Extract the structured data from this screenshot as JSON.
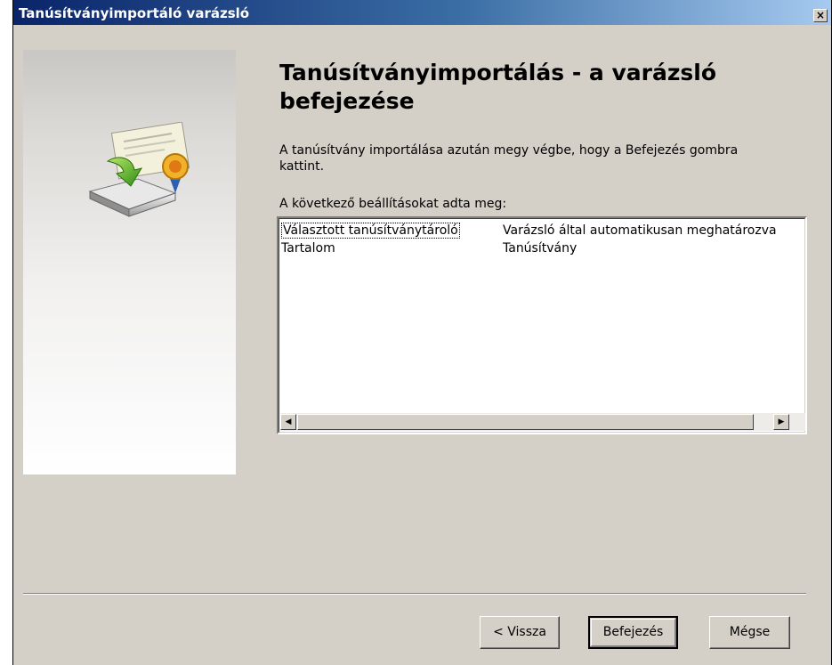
{
  "window": {
    "title": "Tanúsítványimportáló varázsló",
    "close_label": "×"
  },
  "main": {
    "heading": "Tanúsítványimportálás - a varázsló befejezése",
    "description": "A tanúsítvány importálása azután megy végbe, hogy a Befejezés gombra kattint.",
    "settings_label": "A következő beállításokat adta meg:",
    "settings": [
      {
        "name": "Választott tanúsítványtároló",
        "value": "Varázsló által automatikusan meghatározva"
      },
      {
        "name": "Tartalom",
        "value": "Tanúsítvány"
      }
    ]
  },
  "scrollbar": {
    "left_arrow": "◀",
    "right_arrow": "▶"
  },
  "buttons": {
    "back": "< Vissza",
    "finish": "Befejezés",
    "cancel": "Mégse"
  },
  "icons": {
    "wizard": "certificate-import-icon"
  }
}
